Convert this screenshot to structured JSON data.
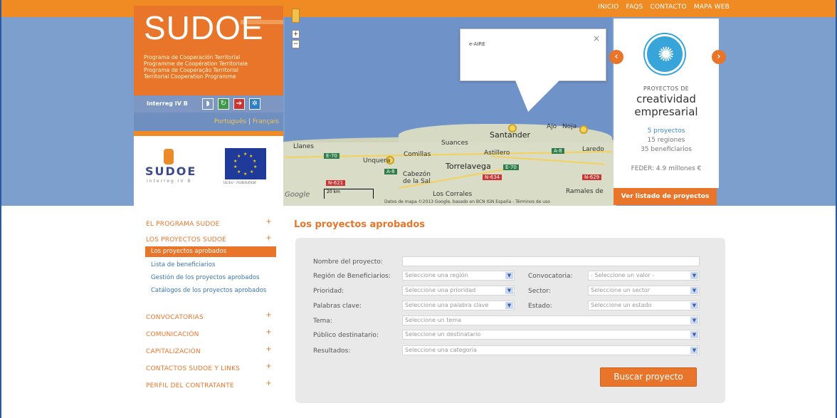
{
  "top_nav": [
    "INICIO",
    "FAQS",
    "CONTACTO",
    "MAPA WEB"
  ],
  "logo": {
    "title": "SUDOE",
    "subtitle_lines": [
      "Programa de Cooperación Territorial",
      "Programme de Coopération Territoriale",
      "Programa de Cooperação Territorial",
      "Territorial Cooperation Programme"
    ],
    "interreg": "Interreg IV B",
    "languages": [
      "Português",
      "|",
      "Français"
    ],
    "partner_logo_text": "SUDOE",
    "partner_logo_sub": "Interreg IV B",
    "eu_caption": "UE/EU - FEDER/ERDF"
  },
  "map": {
    "info_text": "e-AIRE",
    "close_label": "×",
    "cities": {
      "santander": "Santander",
      "suances": "Suances",
      "astillero": "Astillero",
      "ajo": "Ajo",
      "noja": "Noja",
      "laredo": "Laredo",
      "llanes": "Llanes",
      "unquera": "Unquera",
      "comillas": "Comillas",
      "torrelavega": "Torrelavega",
      "cabezon": "Cabezón de la Sal",
      "los_corrales": "Los Corrales",
      "ramales": "Ramales de"
    },
    "scale_label": "20 km",
    "google_label": "Google",
    "attribution": "Datos de mapa ©2013 Google, basado en BCN IGN España - Términos de uso"
  },
  "project_card": {
    "kicker": "PROYECTOS DE",
    "title_line1": "creatividad",
    "title_line2": "empresarial",
    "projects": "5 proyectos",
    "regions": "15 regiones",
    "beneficiaries": "35 beneficiarios",
    "feder": "FEDER: 4.9 millones €",
    "button": "Ver listado de proyectos",
    "prev": "‹",
    "next": "›"
  },
  "sidebar": {
    "items": [
      {
        "label": "EL PROGRAMA SUDOE"
      },
      {
        "label": "LOS PROYECTOS SUDOE"
      }
    ],
    "sub_items": [
      "Los proyectos aprobados",
      "Lista de beneficiarios",
      "Gestión de los proyectos aprobados",
      "Catálogos de los proyectos aprobados"
    ],
    "more_items": [
      "CONVOCATORIAS",
      "COMUNICACIÓN",
      "CAPITALIZACIÓN",
      "CONTACTOS SUDOE Y LINKS",
      "PERFIL DEL CONTRATANTE"
    ]
  },
  "main": {
    "title": "Los proyectos aprobados",
    "form": {
      "nombre_label": "Nombre del proyecto:",
      "nombre_value": "",
      "region_label": "Región de Beneficiarios:",
      "region_value": "Seleccione una región",
      "convocatoria_label": "Convocatoria:",
      "convocatoria_value": "- Seleccione un valor -",
      "prioridad_label": "Prioridad:",
      "prioridad_value": "Seleccione una prioridad",
      "sector_label": "Sector:",
      "sector_value": "Seleccione un sector",
      "palabras_label": "Palabras clave:",
      "palabras_value": "Seleccione una palabra clave",
      "estado_label": "Estado:",
      "estado_value": "Seleccione un estado",
      "tema_label": "Tema:",
      "tema_value": "Seleccione un tema",
      "publico_label": "Público destinatario:",
      "publico_value": "Seleccione un destinatario",
      "resultados_label": "Resultados:",
      "resultados_value": "Seleccione una categoría",
      "search_button": "Buscar proyecto"
    }
  },
  "colors": {
    "orange": "#e8752a",
    "blue": "#7c9fcd",
    "link": "#3a75b5"
  }
}
